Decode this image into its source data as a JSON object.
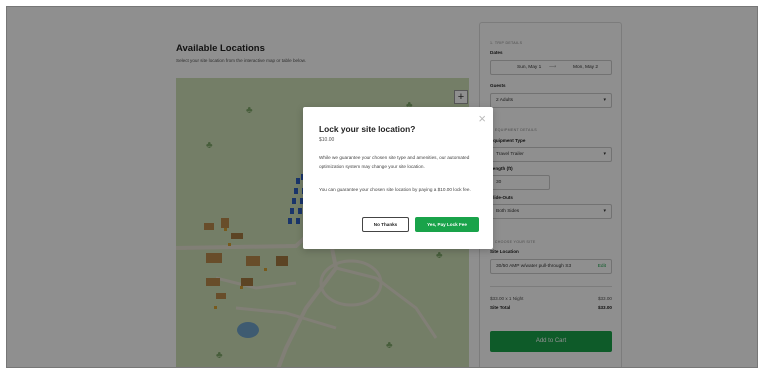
{
  "left": {
    "title": "Available Locations",
    "subtitle": "Select your site location from the interactive map or table below."
  },
  "map": {
    "zoom_in_label": "+"
  },
  "panel": {
    "trip_header": "1. TRIP DETAILS",
    "dates_label": "Dates",
    "start_date": "Sun, May 1",
    "arrow": "⟶",
    "end_date": "Mon, May 2",
    "guests_label": "Guests",
    "guests_value": "2 Adults",
    "equipment_header": "2. EQUIPMENT DETAILS",
    "equipment_type_label": "Equipment Type",
    "equipment_type_value": "Travel Trailer",
    "length_label": "Length (ft)",
    "length_value": "30",
    "slideouts_label": "Slide-Outs",
    "slideouts_value": "Both Sides",
    "site_header": "3. CHOOSE YOUR SITE",
    "site_location_label": "Site Location",
    "site_location_value": "30/50 AMP w/water pull-through S3",
    "edit_label": "Edit",
    "nightly_label": "$33.00 x 1 Night",
    "nightly_value": "$33.00",
    "total_label": "Site Total",
    "total_value": "$33.00",
    "cart_button": "Add to Cart"
  },
  "modal": {
    "close_icon": "close-icon",
    "close_glyph": "×",
    "title": "Lock your site location?",
    "price": "$10.00",
    "paragraph1": "While we guarantee your chosen site type and amenities, our automated optimization system may change your site location.",
    "paragraph2": "You can guarantee your chosen site location by paying a $10.00 lock fee.",
    "no_button": "No Thanks",
    "yes_button": "Yes, Pay Lock Fee"
  },
  "colors": {
    "accent_green": "#19a34a",
    "map_grass": "#cfe0b8",
    "overlay": "rgba(0,0,0,0.44)"
  }
}
